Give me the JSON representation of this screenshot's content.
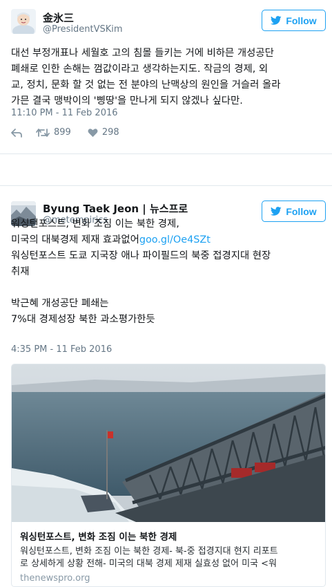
{
  "tweet1": {
    "name": "金氷三",
    "handle": "@PresidentVSKim",
    "follow_label": "Follow",
    "text_lines": [
      "대선 부정개표나 세월호 고의 침몰 들키는 거에 비하믄 개성공단",
      "폐쇄로 인한 손해는 껌값이라고 생각하는지도. 작금의 경제, 외",
      "교, 정치, 문화 할 것 없는 전 분야의 난맥상의 원인을 거슬러 올라",
      "가믄 결국 맹박이의 '삥땅'을 만나게 되지 않겠나 싶다만."
    ],
    "timestamp": "11:10 PM - 11 Feb 2016",
    "retweets": "899",
    "likes": "298"
  },
  "tweet2": {
    "name": "Byung Taek Jeon | 뉴스프로",
    "handle": "@metempirics",
    "follow_label": "Follow",
    "line1": "워싱턴포스트, 변화 조짐 이는 북한 경제,",
    "line2_text": "미국의 대북경제 제재 효과없어",
    "line2_link": "goo.gl/Oe4SZt",
    "line3": "워싱턴포스트 도쿄 지국장 애나 파이필드의 북중 접경지대 현장",
    "line4": "취재",
    "line5": "박근혜 개성공단 폐쇄는",
    "line6": "7%대 경제성장 북한 과소평가한듯",
    "timestamp": "4:35 PM - 11 Feb 2016",
    "card": {
      "title": "워싱턴포스트, 변화 조짐 이는 북한 경제",
      "desc_line1": "워싱턴포스트, 변화 조짐 이는 북한 경제- 북-중 접경지대 현지 리포트",
      "desc_line2": "로 상세하게 상황 전해- 미국의 대북 경제 제재 실효성 없어 미국 <워",
      "domain": "thenewspro.org"
    }
  },
  "colors": {
    "accent": "#1da1f2",
    "muted": "#657786",
    "text": "#14171a",
    "border": "#e1e8ed"
  },
  "icons": {
    "follow": "twitter-bird-icon",
    "reply": "reply-arrow-icon",
    "retweet": "retweet-icon",
    "like": "heart-icon"
  }
}
